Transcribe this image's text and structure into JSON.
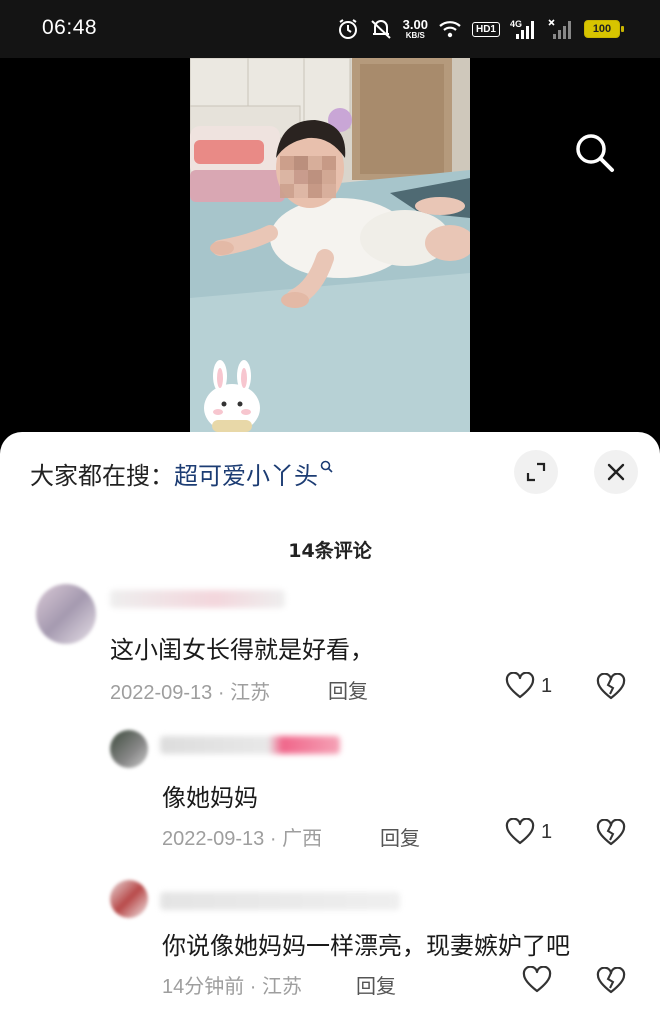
{
  "status_bar": {
    "time": "06:48",
    "net_speed_value": "3.00",
    "net_speed_unit": "KB/S",
    "hd_label": "HD1",
    "signal_label": "4G",
    "battery": "100",
    "icons": [
      "alarm-icon",
      "mute-icon",
      "wifi-icon",
      "signal-icon",
      "no-signal-icon",
      "battery-icon"
    ]
  },
  "video": {
    "search_icon": "search-icon"
  },
  "sheet": {
    "search_prefix": "大家都在搜：",
    "search_keyword": "超可爱小丫头",
    "comment_count": "14条评论"
  },
  "comments": [
    {
      "text": "这小闺女长得就是好看，",
      "date": "2022-09-13",
      "location": "江苏",
      "reply_label": "回复",
      "likes": "1"
    },
    {
      "text": "像她妈妈",
      "date": "2022-09-13",
      "location": "广西",
      "reply_label": "回复",
      "likes": "1"
    },
    {
      "text": "你说像她妈妈一样漂亮，现妻嫉妒了吧",
      "date": "14分钟前",
      "location": "江苏",
      "reply_label": "回复",
      "likes": ""
    }
  ],
  "colors": {
    "accent": "#1c3c73",
    "meta": "#9e9e9e",
    "battery": "#d7c400"
  }
}
